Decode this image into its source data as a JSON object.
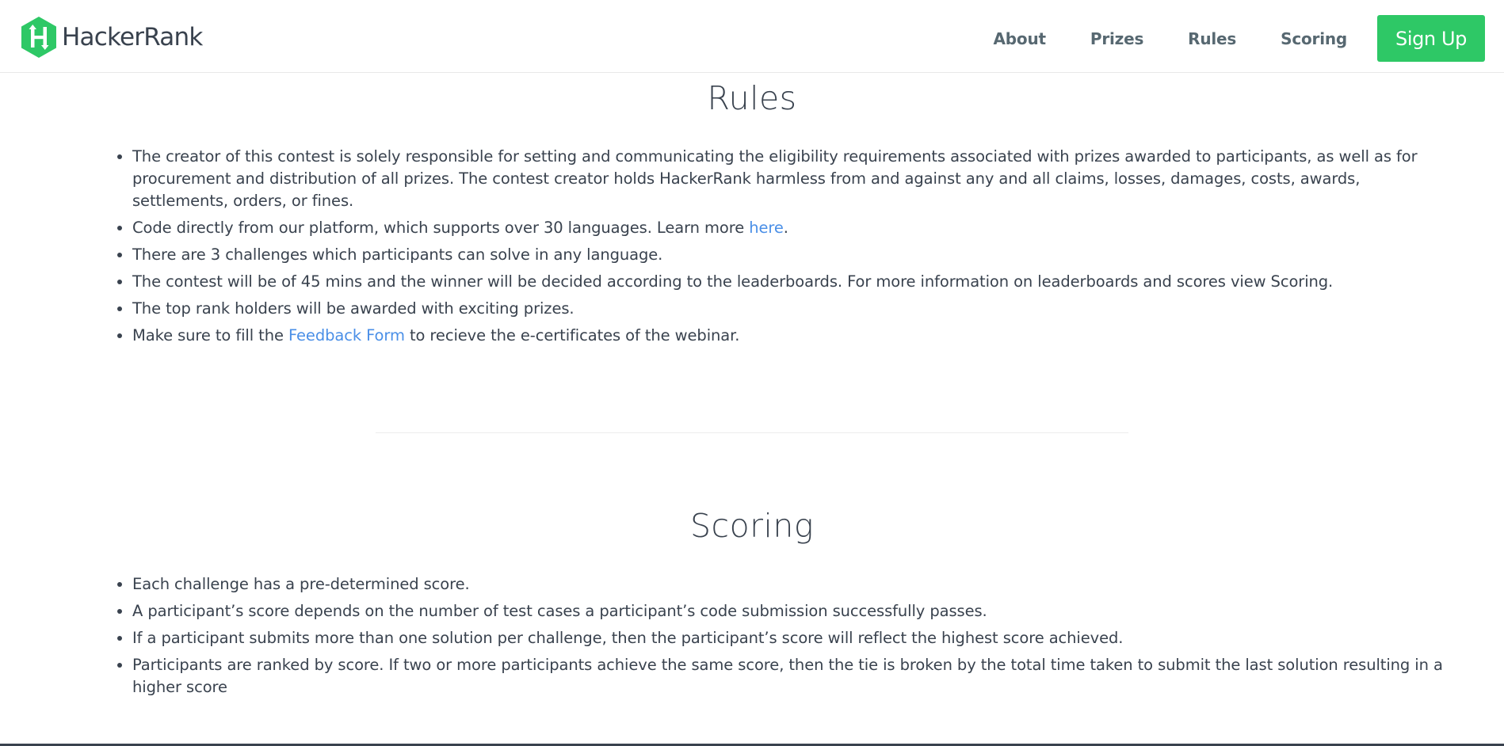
{
  "header": {
    "logo_text": "HackerRank",
    "logo_letter": "H",
    "brand_color": "#2ec866",
    "nav": [
      {
        "label": "About"
      },
      {
        "label": "Prizes"
      },
      {
        "label": "Rules"
      },
      {
        "label": "Scoring"
      }
    ],
    "signup_label": "Sign Up"
  },
  "rules": {
    "title": "Rules",
    "item_1": "The creator of this contest is solely responsible for setting and communicating the eligibility requirements associated with prizes awarded to participants, as well as for procurement and distribution of all prizes. The contest creator holds HackerRank harmless from and against any and all claims, losses, damages, costs, awards, settlements, orders, or fines.",
    "item_2_before": "Code directly from our platform, which supports over 30 languages. Learn more ",
    "item_2_link": "here",
    "item_2_after": ".",
    "item_3": "There are 3 challenges which participants can solve in any language.",
    "item_4": "The contest will be of 45 mins and the winner will be decided according to the leaderboards. For more information on leaderboards and scores view Scoring.",
    "item_5": "The top rank holders will be awarded with exciting prizes.",
    "item_6_before": "Make sure to fill the ",
    "item_6_link": "Feedback Form",
    "item_6_after": " to recieve the e-certificates of the webinar."
  },
  "scoring": {
    "title": "Scoring",
    "items": [
      "Each challenge has a pre-determined score.",
      "A participant’s score depends on the number of test cases a participant’s code submission successfully passes.",
      "If a participant submits more than one solution per challenge, then the participant’s score will reflect the highest score achieved.",
      "Participants are ranked by score. If two or more participants achieve the same score, then the tie is broken by the total time taken to submit the last solution resulting in a higher score"
    ]
  },
  "icons": {
    "logo": "hackerrank-hexagon-icon"
  },
  "colors": {
    "link": "#4a8fe7",
    "text": "#39424e",
    "nav_text": "#576871"
  }
}
